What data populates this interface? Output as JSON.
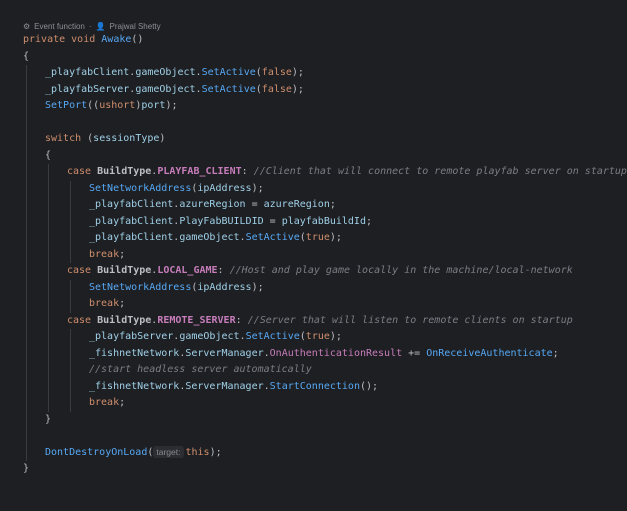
{
  "hint": {
    "kind": "Event function",
    "separator": "·",
    "author": "Prajwal Shetty"
  },
  "code": {
    "lines": [
      [
        "private void ",
        "Awake",
        "()"
      ],
      [
        "{"
      ],
      [
        "_playfabClient",
        ".",
        "gameObject",
        ".",
        "SetActive",
        "(",
        "false",
        ");"
      ],
      [
        "_playfabServer",
        ".",
        "gameObject",
        ".",
        "SetActive",
        "(",
        "false",
        ");"
      ],
      [
        "SetPort",
        "((",
        "ushort",
        ")",
        "port",
        ");"
      ],
      [
        ""
      ],
      [
        "switch",
        " (",
        "sessionType",
        ")"
      ],
      [
        "{"
      ],
      [
        "case ",
        "BuildType",
        ".",
        "PLAYFAB_CLIENT",
        ": ",
        "//Client that will connect to remote playfab server on startup"
      ],
      [
        "SetNetworkAddress",
        "(",
        "ipAddress",
        ");"
      ],
      [
        "_playfabClient",
        ".",
        "azureRegion",
        " = ",
        "azureRegion",
        ";"
      ],
      [
        "_playfabClient",
        ".",
        "PlayFabBUILDID",
        " = ",
        "playfabBuildId",
        ";"
      ],
      [
        "_playfabClient",
        ".",
        "gameObject",
        ".",
        "SetActive",
        "(",
        "true",
        ");"
      ],
      [
        "break",
        ";"
      ],
      [
        "case ",
        "BuildType",
        ".",
        "LOCAL_GAME",
        ": ",
        "//Host and play game locally in the machine/local-network"
      ],
      [
        "SetNetworkAddress",
        "(",
        "ipAddress",
        ");"
      ],
      [
        "break",
        ";"
      ],
      [
        "case ",
        "BuildType",
        ".",
        "REMOTE_SERVER",
        ": ",
        "//Server that will listen to remote clients on startup"
      ],
      [
        "_playfabServer",
        ".",
        "gameObject",
        ".",
        "SetActive",
        "(",
        "true",
        ");"
      ],
      [
        "_fishnetNetwork",
        ".",
        "ServerManager",
        ".",
        "OnAuthenticationResult",
        " += ",
        "OnReceiveAuthenticate",
        ";"
      ],
      [
        "//start headless server automatically"
      ],
      [
        "_fishnetNetwork",
        ".",
        "ServerManager",
        ".",
        "StartConnection",
        "();"
      ],
      [
        "break",
        ";"
      ],
      [
        "}"
      ],
      [
        ""
      ],
      [
        "DontDestroyOnLoad",
        "(",
        "target:",
        "this",
        ");"
      ],
      [
        "}"
      ]
    ]
  },
  "colors": {
    "background": "#1e1f22",
    "keyword": "#cf8e6d",
    "method": "#56a8f5",
    "field": "#9fd0e8",
    "member": "#c77dbb",
    "comment": "#7a7e85",
    "text": "#bcbec4"
  },
  "icons": {
    "hint_icon": "gear-icon",
    "author_icon": "person-icon"
  }
}
